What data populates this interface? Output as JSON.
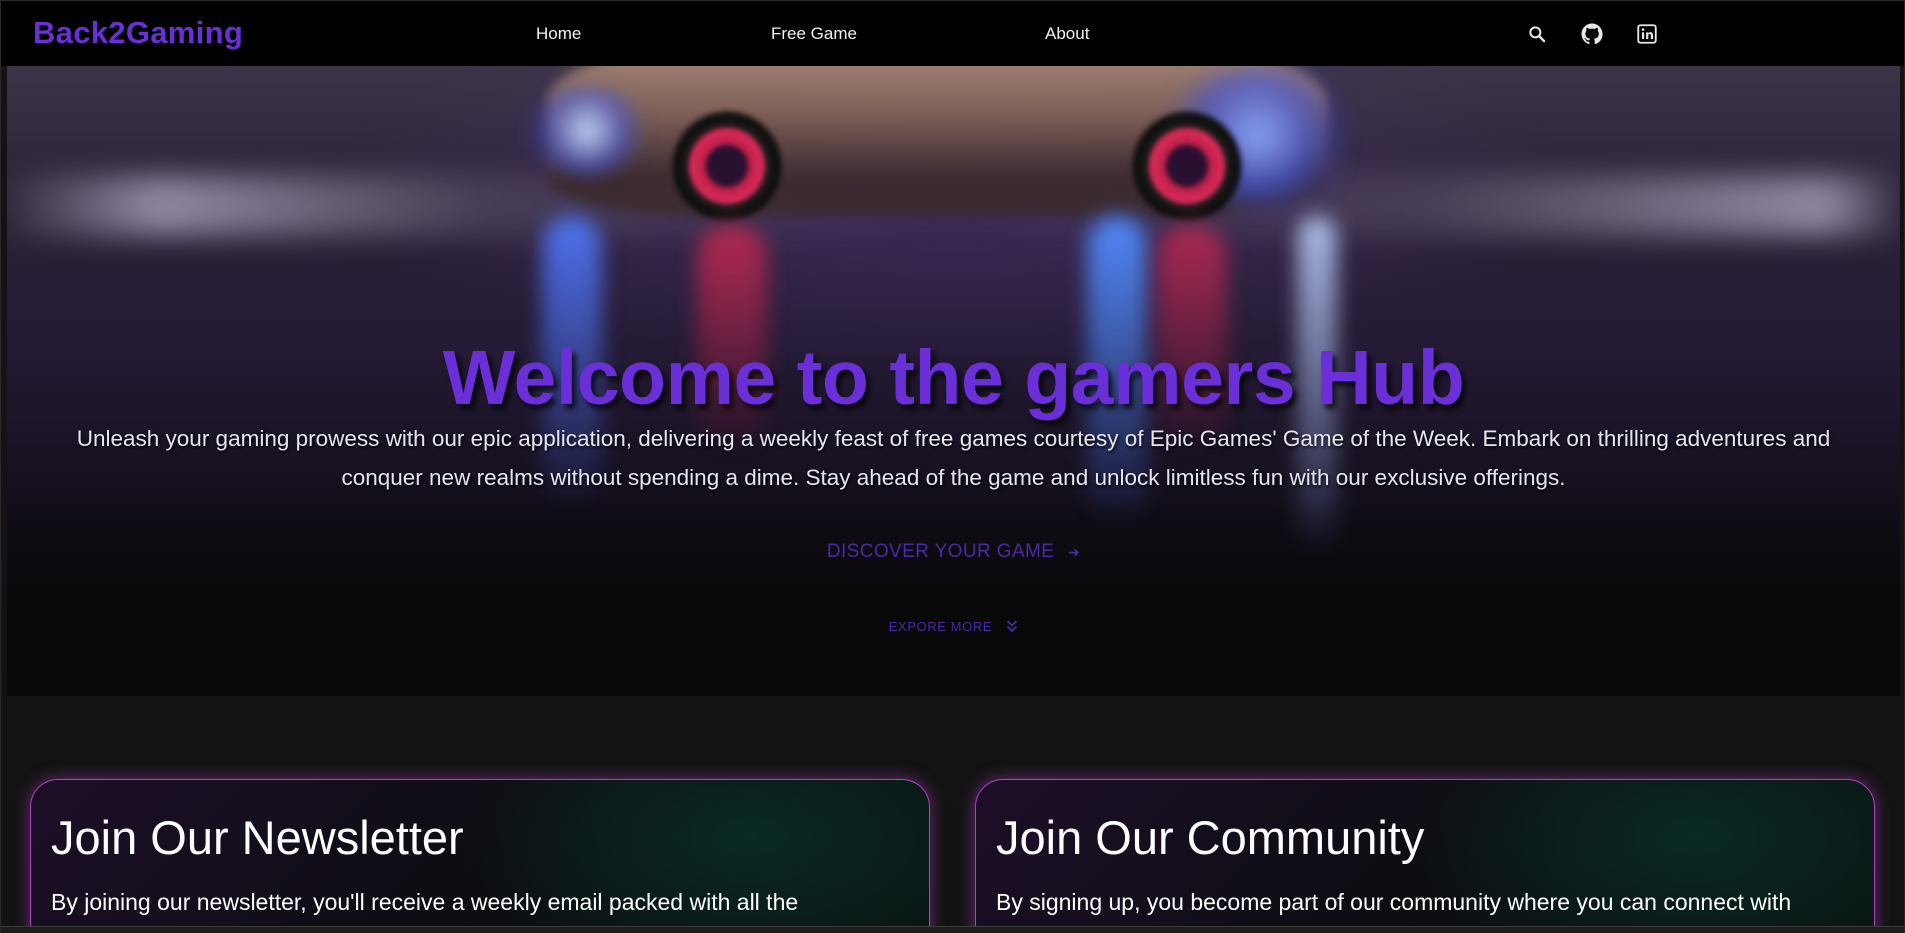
{
  "navbar": {
    "brand": "Back2Gaming",
    "links": [
      "Home",
      "Free Game",
      "About"
    ],
    "icons": [
      "search-icon",
      "github-icon",
      "linkedin-icon"
    ]
  },
  "hero": {
    "title": "Welcome to the gamers Hub",
    "description_line1": "Unleash your gaming prowess with our epic application, delivering a weekly feast of free games courtesy of Epic Games' Game of the Week. Embark on thrilling adventures and",
    "description_line2": "conquer new realms without spending a dime. Stay ahead of the game and unlock limitless fun with our exclusive offerings.",
    "cta_label": "DISCOVER YOUR GAME",
    "cta_arrow": "➜",
    "explore_label": "EXPORE MORE"
  },
  "cards": {
    "newsletter": {
      "title": "Join Our Newsletter",
      "text": "By joining our newsletter, you'll receive a weekly email packed with all the"
    },
    "community": {
      "title": "Join Our Community",
      "text": "By signing up, you become part of our community where you can connect with"
    }
  },
  "colors": {
    "brand": "#6a2fd6",
    "nav_background": "#000000",
    "page_background": "#131313",
    "card_border": "#b040c0",
    "cta": "#4a2aa5"
  }
}
